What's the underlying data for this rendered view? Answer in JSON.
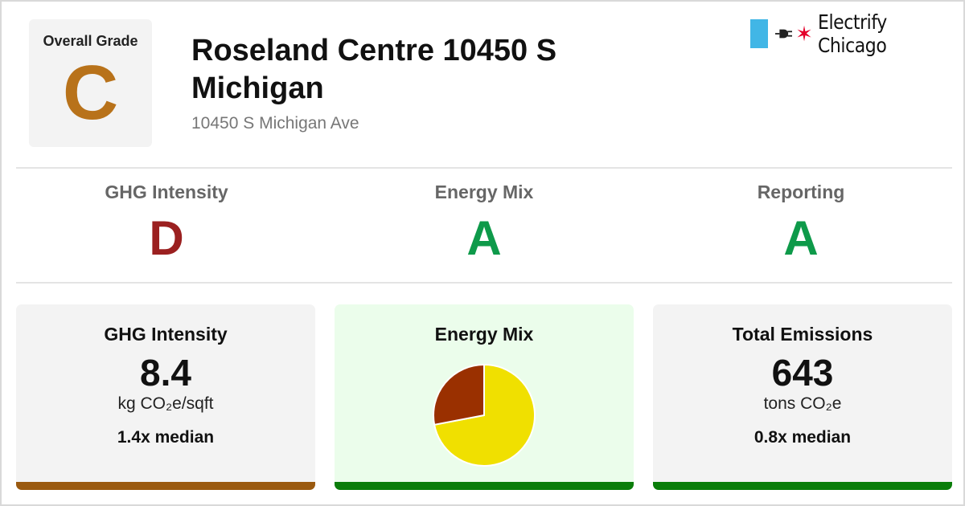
{
  "header": {
    "overall_grade_label": "Overall Grade",
    "overall_grade": "C",
    "overall_grade_color": "#b8721a",
    "title": "Roseland Centre 10450 S Michigan",
    "address": "10450 S Michigan Ave"
  },
  "brand": {
    "name": "Electrify Chicago",
    "flag_color": "#41b6e6",
    "star_color": "#e4002b",
    "icons": [
      "chicago-flag-bar-icon",
      "plug-icon",
      "chicago-star-icon"
    ]
  },
  "subgrades": [
    {
      "label": "GHG Intensity",
      "grade": "D",
      "color": "#9b2020"
    },
    {
      "label": "Energy Mix",
      "grade": "A",
      "color": "#0e9a4a"
    },
    {
      "label": "Reporting",
      "grade": "A",
      "color": "#0e9a4a"
    }
  ],
  "cards": {
    "ghg_intensity": {
      "title": "GHG Intensity",
      "value": "8.4",
      "unit": "kg CO₂e/sqft",
      "median": "1.4x median",
      "bar_color": "#9a5a10"
    },
    "energy_mix": {
      "title": "Energy Mix",
      "background": "#ebfdeb",
      "bar_color": "#0a7d0a",
      "pie": [
        {
          "share": 0.72,
          "color": "#f0e000"
        },
        {
          "share": 0.28,
          "color": "#9a3000"
        }
      ]
    },
    "total_emissions": {
      "title": "Total Emissions",
      "value": "643",
      "unit": "tons CO₂e",
      "median": "0.8x median",
      "bar_color": "#0a7d0a"
    }
  }
}
